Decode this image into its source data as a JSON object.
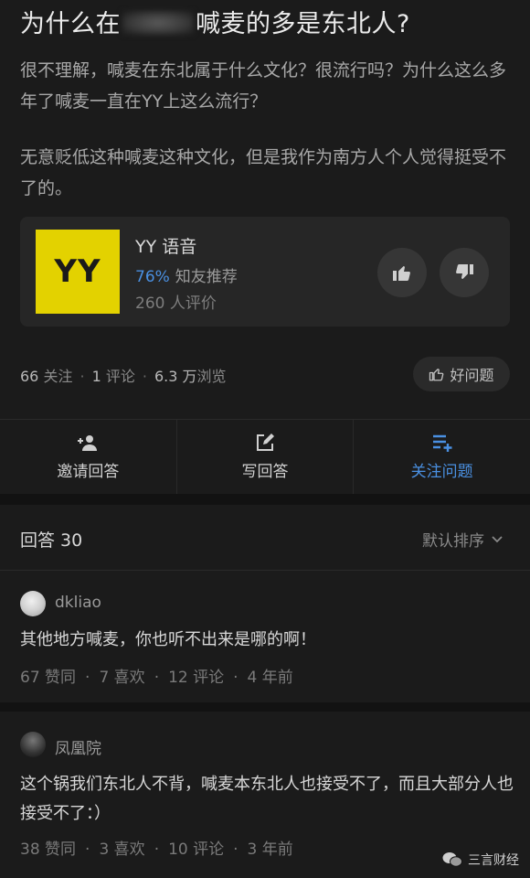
{
  "question": {
    "title_start": "为什么在",
    "title_end": "喊麦的多是东北人?",
    "desc_p1": "很不理解，喊麦在东北属于什么文化？很流行吗？为什么这么多年了喊麦一直在YY上这么流行？",
    "desc_p2": "无意贬低这种喊麦这种文化，但是我作为南方人个人觉得挺受不了的。"
  },
  "app_card": {
    "logo_text": "YY",
    "name": "YY 语音",
    "recommend_pct": "76%",
    "recommend_label": "知友推荐",
    "review_count": "260 人评价",
    "logo_color": "#e3d200"
  },
  "stats": {
    "follow_num": "66",
    "follow_label": "关注",
    "comment_num": "1",
    "comment_label": "评论",
    "views_num": "6.3 万",
    "views_label": "浏览",
    "good_question": "好问题"
  },
  "actions": {
    "invite": "邀请回答",
    "write": "写回答",
    "follow": "关注问题"
  },
  "answers_header": {
    "count": "回答 30",
    "sort": "默认排序"
  },
  "answers": [
    {
      "author": "dkliao",
      "text": "其他地方喊麦，你也听不出来是哪的啊！",
      "likes": "67 赞同",
      "favs": "7 喜欢",
      "comments": "12 评论",
      "time": "4 年前"
    },
    {
      "author": "凤凰院",
      "text": "这个锅我们东北人不背，喊麦本东北人也接受不了，而且大部分人也接受不了：）",
      "likes": "38 赞同",
      "favs": "3 喜欢",
      "comments": "10 评论",
      "time": "3 年前"
    }
  ],
  "watermark": "三言财经",
  "colors": {
    "accent": "#4a90e2",
    "bg": "#121212",
    "panel": "#1b1b1b"
  }
}
